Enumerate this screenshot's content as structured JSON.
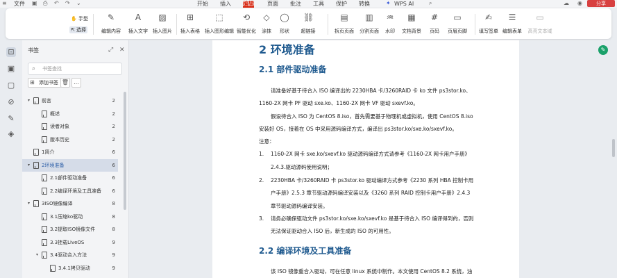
{
  "menubar": {
    "file": "文件",
    "tabs": [
      "开始",
      "插入",
      "编辑",
      "页面",
      "批注",
      "工具",
      "保护",
      "转换"
    ],
    "active_tab": "编辑",
    "wps_ai": "WPS AI",
    "share": "分享"
  },
  "ribbon": {
    "hand_tool": "手型",
    "select_tool": "选择",
    "buttons": [
      "编辑内容",
      "插入文字",
      "插入图片",
      "插入表格",
      "插入图形编辑",
      "智能优化",
      "涂抹",
      "形状",
      "超链接",
      "拆页页面",
      "分割页面",
      "水印",
      "文档背景",
      "页码",
      "页眉页脚",
      "填写签单",
      "编辑表单",
      "高亮文本域"
    ]
  },
  "bookmark_panel": {
    "title": "书签",
    "search_placeholder": "书签查找",
    "add_bookmark": "添加书签",
    "items": [
      {
        "label": "前言",
        "page": "2",
        "level": 0,
        "expandable": true
      },
      {
        "label": "概述",
        "page": "2",
        "level": 1
      },
      {
        "label": "读者对象",
        "page": "2",
        "level": 1
      },
      {
        "label": "版本历史",
        "page": "2",
        "level": 1
      },
      {
        "label": "1简介",
        "page": "6",
        "level": 0
      },
      {
        "label": "2环境准备",
        "page": "6",
        "level": 0,
        "expandable": true,
        "active": true
      },
      {
        "label": "2.1部件驱动准备",
        "page": "6",
        "level": 1
      },
      {
        "label": "2.2编译环境及工具准备",
        "page": "6",
        "level": 1
      },
      {
        "label": "3ISO镜像编译",
        "page": "8",
        "level": 0,
        "expandable": true
      },
      {
        "label": "3.1压缩ko驱动",
        "page": "8",
        "level": 1
      },
      {
        "label": "3.2提取ISO镜像文件",
        "page": "8",
        "level": 1
      },
      {
        "label": "3.3挂载LiveOS",
        "page": "9",
        "level": 1
      },
      {
        "label": "3.4驱动合入方法",
        "page": "9",
        "level": 1,
        "expandable": true
      },
      {
        "label": "3.4.1拷贝驱动",
        "page": "9",
        "level": 2
      }
    ]
  },
  "document": {
    "h1": "2 环境准备",
    "h2_1": "2.1 部件驱动准备",
    "p1": "请准备好基于待合入 ISO 编译出的 2230HBA 卡/3260RAID 卡 ko 文件 ps3stor.ko、",
    "p2": "1160-2X 网卡 PF 驱动 sxe.ko、1160-2X 网卡 VF 驱动 sxevf.ko。",
    "p3": "假设待合入 ISO 为 CentOS 8.iso，首先需要基于物理机或虚拟机，使用 CentOS 8.iso",
    "p4": "安装好 OS，接着在 OS 中采用源码编译方式，编译出 ps3stor.ko/sxe.ko/sxevf.ko。",
    "note": "注意：",
    "li1_num": "1.",
    "li1_a": "1160-2X 网卡 sxe.ko/sxevf.ko 驱动源码编译方式请参考《1160-2X 网卡用户手册》",
    "li1_b": "2.4.3.驱动源码使用说明；",
    "li2_num": "2.",
    "li2_a": "2230HBA 卡/3260RAID 卡 ps3stor.ko 驱动编译方式参考《2230 系列 HBA 控制卡用",
    "li2_b": "户手册》2.5.3 章节驱动源码编译安装以及《3260 系列 RAID 控制卡用户手册》2.4.3",
    "li2_c": "章节驱动源码编译安装。",
    "li3_num": "3.",
    "li3_a": "请务必确保驱动文件 ps3stor.ko/sxe.ko/sxevf.ko 是基于待合入 ISO 编译得到的，否则",
    "li3_b": "无法保证驱动合入 ISO 后，新生成的 ISO 的可用性。",
    "h2_2": "2.2 编译环境及工具准备",
    "p5": "该 ISO 镜像重合入驱动，可在任意 linux 系统中制作。本文使用 CentOS 8.2 系统，油"
  },
  "colors": {
    "accent": "#d81e06",
    "heading": "#1f5a8f",
    "active_bookmark_bg": "#d5dce8"
  }
}
